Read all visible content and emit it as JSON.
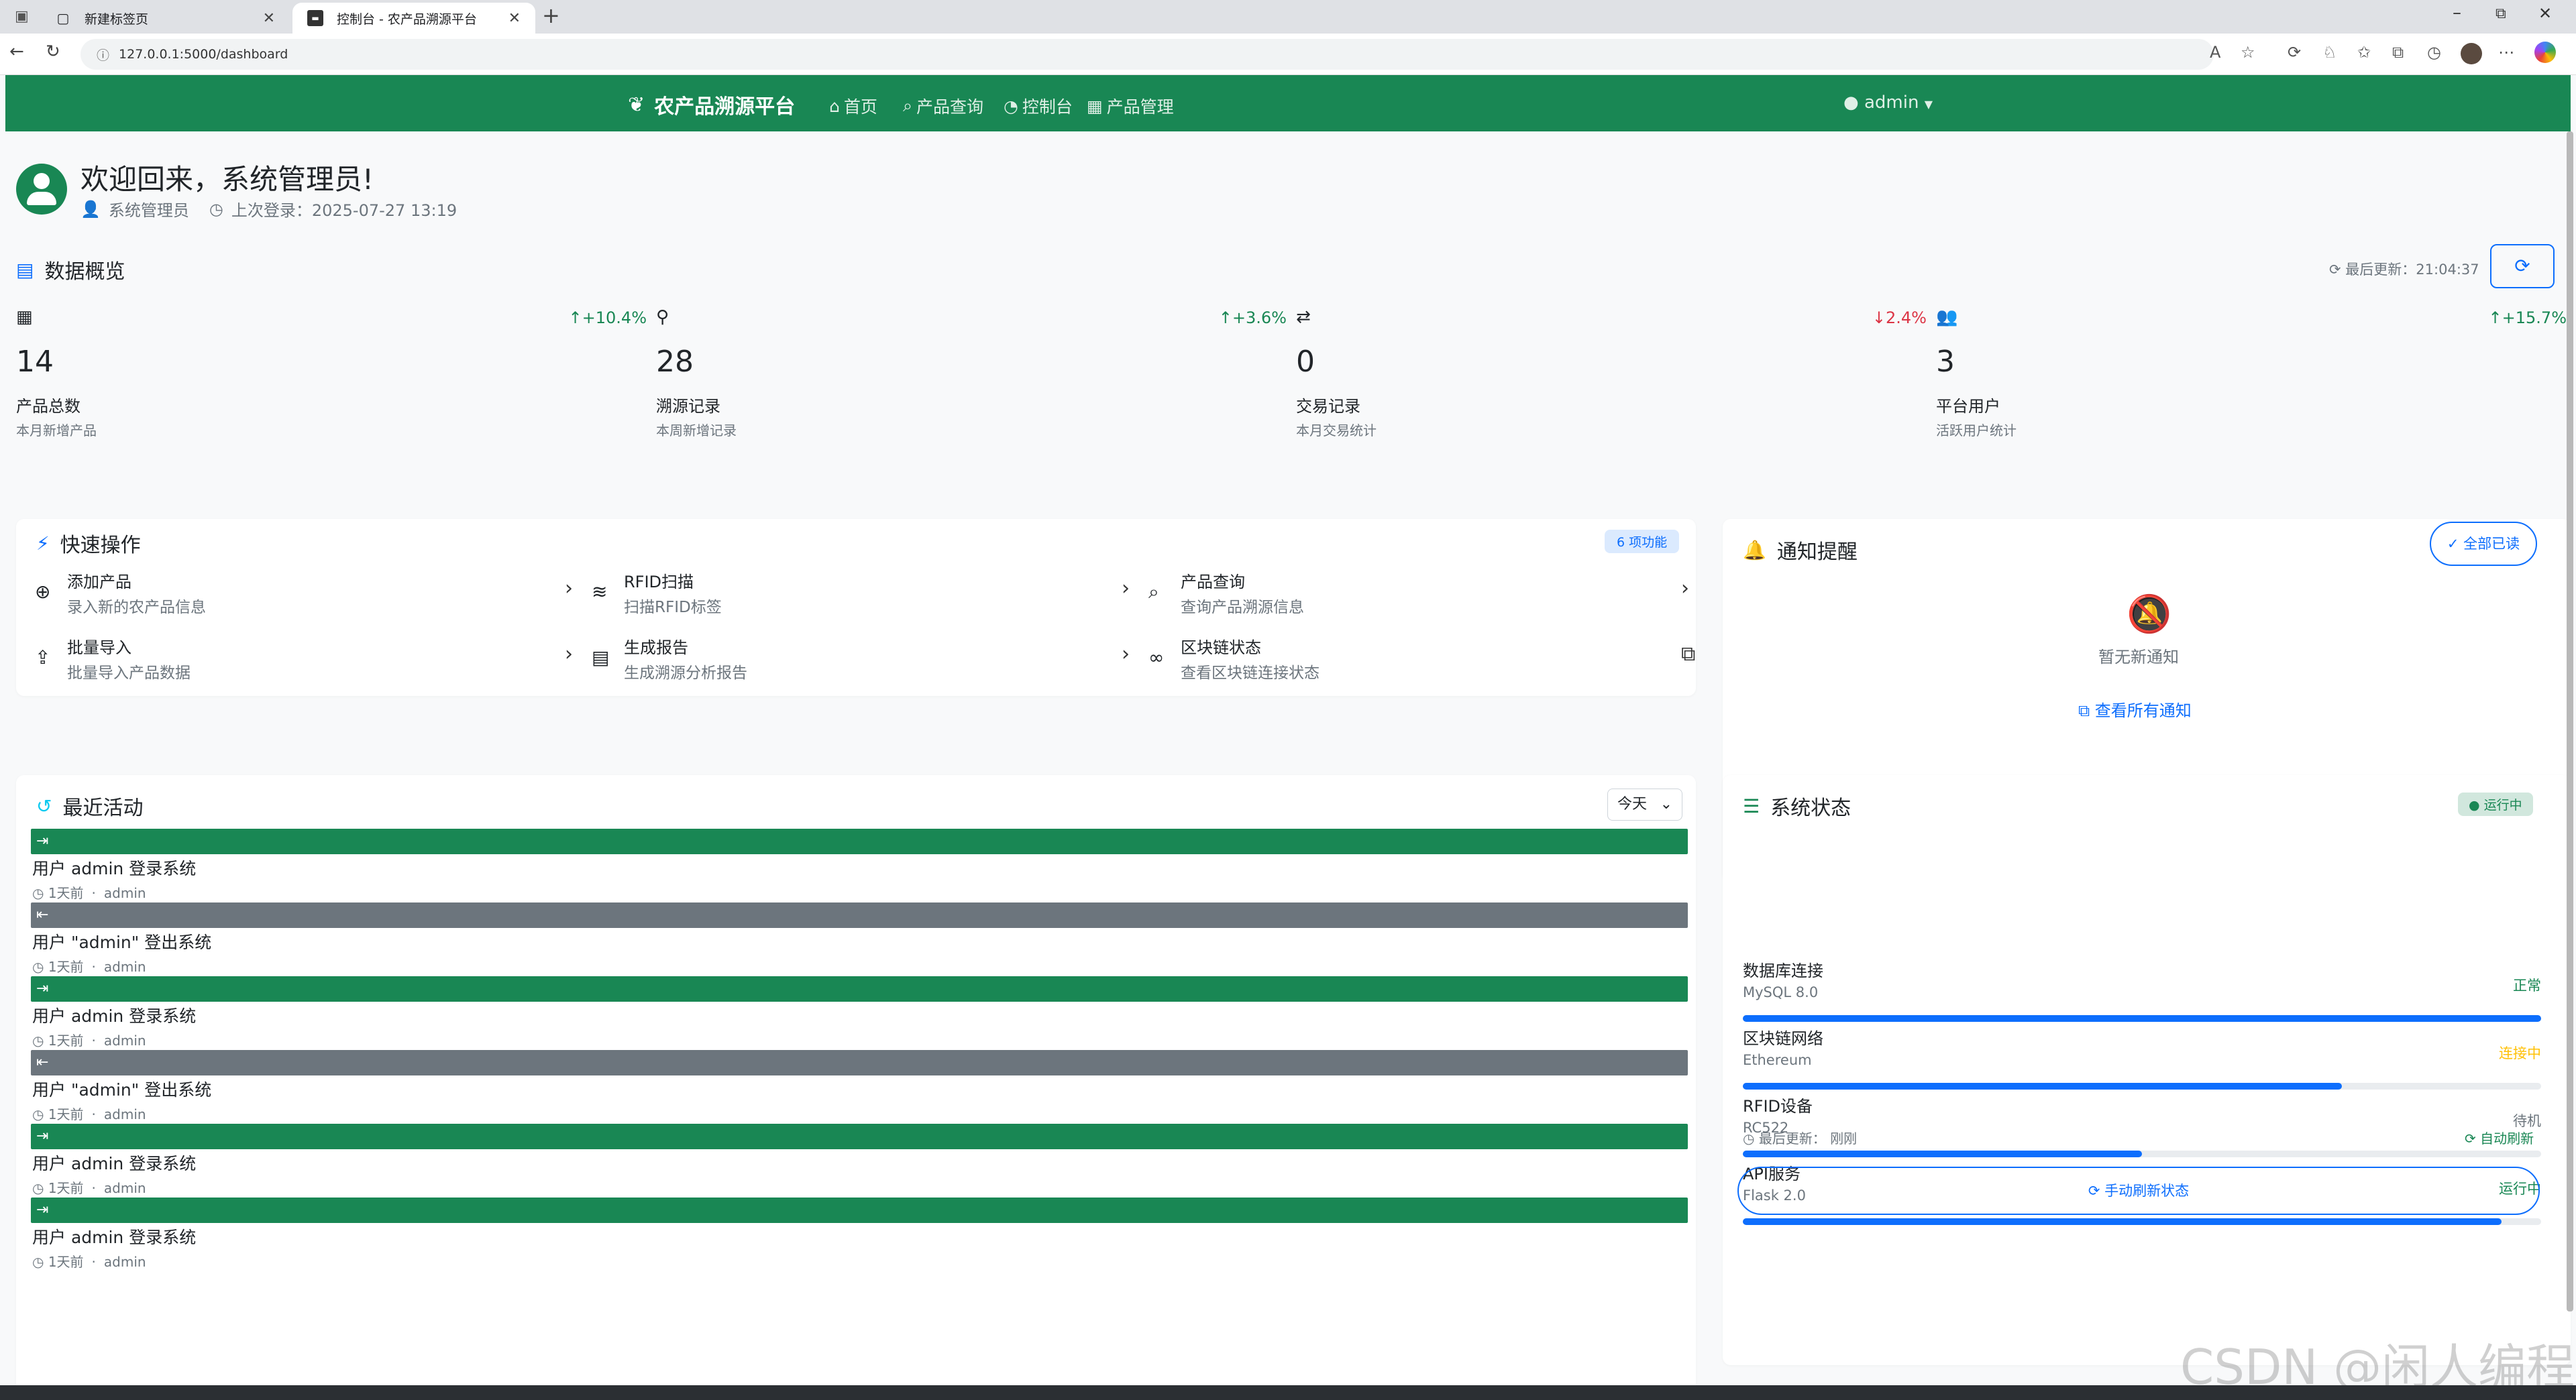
{
  "browser": {
    "tabs": [
      {
        "title": "新建标签页"
      },
      {
        "title": "控制台 - 农产品溯源平台"
      }
    ],
    "url": "127.0.0.1:5000/dashboard"
  },
  "navbar": {
    "brand": "农产品溯源平台",
    "links": [
      "首页",
      "产品查询",
      "控制台",
      "产品管理"
    ],
    "user": "admin"
  },
  "welcome": {
    "title": "欢迎回来，系统管理员!",
    "role": "系统管理员",
    "last_login": "上次登录：2025-07-27 13:19"
  },
  "overview": {
    "title": "数据概览",
    "last_update": "最后更新：21:04:37",
    "stats": [
      {
        "value": "14",
        "label": "产品总数",
        "sub": "本月新增产品",
        "change": "+10.4%",
        "trend": "up"
      },
      {
        "value": "28",
        "label": "溯源记录",
        "sub": "本周新增记录",
        "change": "+3.6%",
        "trend": "up"
      },
      {
        "value": "0",
        "label": "交易记录",
        "sub": "本月交易统计",
        "change": "2.4%",
        "trend": "down"
      },
      {
        "value": "3",
        "label": "平台用户",
        "sub": "活跃用户统计",
        "change": "+15.7%",
        "trend": "up"
      }
    ]
  },
  "quick": {
    "title": "快速操作",
    "badge": "6 项功能",
    "items": [
      {
        "title": "添加产品",
        "sub": "录入新的农产品信息"
      },
      {
        "title": "RFID扫描",
        "sub": "扫描RFID标签"
      },
      {
        "title": "产品查询",
        "sub": "查询产品溯源信息"
      },
      {
        "title": "批量导入",
        "sub": "批量导入产品数据"
      },
      {
        "title": "生成报告",
        "sub": "生成溯源分析报告"
      },
      {
        "title": "区块链状态",
        "sub": "查看区块链连接状态"
      }
    ]
  },
  "notify": {
    "title": "通知提醒",
    "mark_all": "全部已读",
    "empty": "暂无新通知",
    "view_all": "查看所有通知"
  },
  "activity": {
    "title": "最近活动",
    "filter": "今天",
    "items": [
      {
        "text": "用户 admin 登录系统",
        "time": "1天前",
        "user": "admin",
        "kind": "login"
      },
      {
        "text": "用户 \"admin\" 登出系统",
        "time": "1天前",
        "user": "admin",
        "kind": "logout"
      },
      {
        "text": "用户 admin 登录系统",
        "time": "1天前",
        "user": "admin",
        "kind": "login"
      },
      {
        "text": "用户 \"admin\" 登出系统",
        "time": "1天前",
        "user": "admin",
        "kind": "logout"
      },
      {
        "text": "用户 admin 登录系统",
        "time": "1天前",
        "user": "admin",
        "kind": "login"
      },
      {
        "text": "用户 admin 登录系统",
        "time": "1天前",
        "user": "admin",
        "kind": "login"
      }
    ]
  },
  "system": {
    "title": "系统状态",
    "badge": "运行中",
    "items": [
      {
        "name": "数据库连接",
        "version": "MySQL 8.0",
        "status": "正常",
        "status_color": "#198754",
        "level": 1.0
      },
      {
        "name": "区块链网络",
        "version": "Ethereum",
        "status": "连接中",
        "status_color": "#ffc107",
        "level": 0.75
      },
      {
        "name": "RFID设备",
        "version": "RC522",
        "status": "待机",
        "status_color": "#6c757d",
        "level": 0.5
      },
      {
        "name": "API服务",
        "version": "Flask 2.0",
        "status": "运行中",
        "status_color": "#198754",
        "level": 0.95
      }
    ],
    "last_update_label": "最后更新：",
    "last_update_value": "刚刚",
    "auto_refresh": "自动刷新",
    "manual_refresh": "手动刷新状态"
  },
  "watermark": "CSDN @闲人编程",
  "colors": {
    "primary": "#198754",
    "secondary": "#6c757d",
    "blue": "#0d6efd",
    "danger": "#dc3545"
  }
}
